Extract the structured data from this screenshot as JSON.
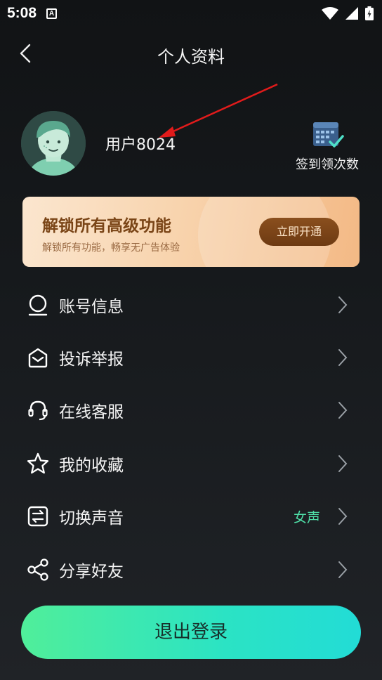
{
  "status_bar": {
    "time": "5:08",
    "notification_glyph": "A"
  },
  "header": {
    "title": "个人资料"
  },
  "profile": {
    "username": "用户8024",
    "checkin_label": "签到领次数"
  },
  "vip_banner": {
    "title": "解锁所有高级功能",
    "subtitle": "解锁所有功能，畅享无广告体验",
    "button_label": "立即开通"
  },
  "menu": [
    {
      "label": "账号信息",
      "icon": "user-icon",
      "value": ""
    },
    {
      "label": "投诉举报",
      "icon": "envelope-icon",
      "value": ""
    },
    {
      "label": "在线客服",
      "icon": "headset-icon",
      "value": ""
    },
    {
      "label": "我的收藏",
      "icon": "star-icon",
      "value": ""
    },
    {
      "label": "切换声音",
      "icon": "switch-icon",
      "value": "女声"
    },
    {
      "label": "分享好友",
      "icon": "share-icon",
      "value": ""
    }
  ],
  "logout_label": "退出登录",
  "colors": {
    "accent_green": "#4fe0a8",
    "vip_brown": "#7a4517",
    "annotation_red": "#e11b1b"
  }
}
